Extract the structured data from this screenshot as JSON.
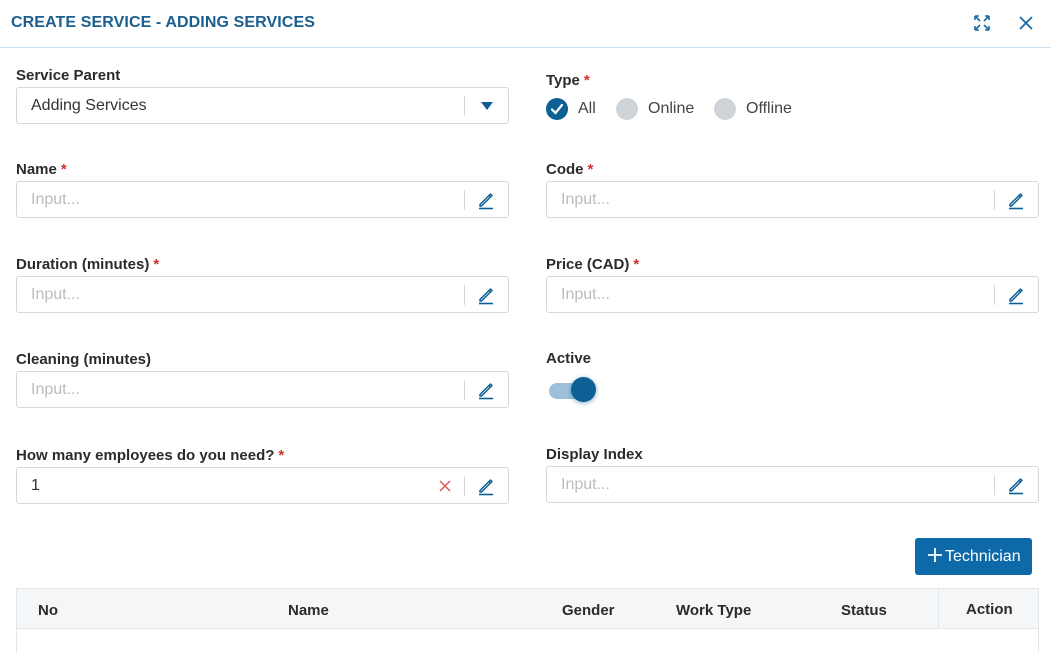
{
  "header": {
    "title": "CREATE SERVICE - ADDING SERVICES"
  },
  "fields": {
    "service_parent": {
      "label": "Service Parent",
      "value": "Adding Services"
    },
    "type": {
      "label": "Type",
      "required": "*",
      "options": [
        {
          "label": "All",
          "selected": true
        },
        {
          "label": "Online",
          "selected": false
        },
        {
          "label": "Offline",
          "selected": false
        }
      ]
    },
    "name": {
      "label": "Name",
      "required": "*",
      "placeholder": "Input...",
      "value": ""
    },
    "code": {
      "label": "Code",
      "required": "*",
      "placeholder": "Input...",
      "value": ""
    },
    "duration": {
      "label": "Duration (minutes)",
      "required": "*",
      "placeholder": "Input...",
      "value": ""
    },
    "price": {
      "label": "Price (CAD)",
      "required": "*",
      "placeholder": "Input...",
      "value": ""
    },
    "cleaning": {
      "label": "Cleaning (minutes)",
      "placeholder": "Input...",
      "value": ""
    },
    "active": {
      "label": "Active",
      "on": true
    },
    "employees": {
      "label": "How many employees do you need?",
      "required": "*",
      "placeholder": "Input...",
      "value": "1"
    },
    "display_index": {
      "label": "Display Index",
      "placeholder": "Input...",
      "value": ""
    }
  },
  "technician_button": {
    "label": "Technician"
  },
  "table": {
    "columns": [
      "No",
      "Name",
      "Gender",
      "Work Type",
      "Status",
      "Action"
    ],
    "rows": []
  },
  "colors": {
    "accent": "#0e5f94",
    "button": "#0e69a8",
    "title": "#1a5f8f",
    "required": "#d0312d",
    "clear_icon": "#e05555"
  },
  "icons": {
    "expand": "expand-icon",
    "close": "close-icon",
    "edit": "pencil-icon",
    "clear": "clear-x-icon",
    "dropdown": "caret-down-icon",
    "add": "plus-icon",
    "check": "check-icon"
  }
}
